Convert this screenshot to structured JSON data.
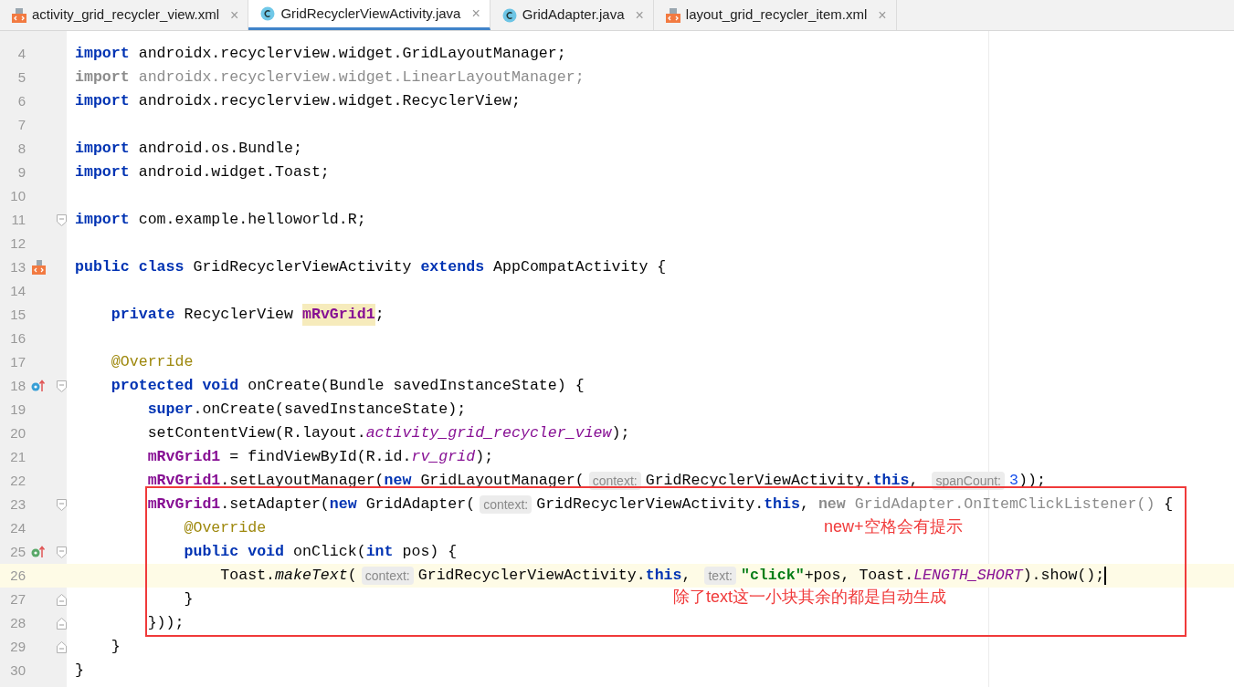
{
  "tabs": [
    {
      "label": "activity_grid_recycler_view.xml",
      "kind": "xml",
      "selected": false,
      "close": "×"
    },
    {
      "label": "GridRecyclerViewActivity.java",
      "kind": "class",
      "selected": true,
      "close": "×"
    },
    {
      "label": "GridAdapter.java",
      "kind": "class",
      "selected": false,
      "close": "×"
    },
    {
      "label": "layout_grid_recycler_item.xml",
      "kind": "xml",
      "selected": false,
      "close": "×"
    }
  ],
  "editor": {
    "lines": [
      {
        "number": "4",
        "tokens": [
          {
            "kind": "kw",
            "text": "import"
          },
          {
            "kind": "plain",
            "text": " androidx.recyclerview.widget.GridLayoutManager;"
          }
        ]
      },
      {
        "number": "5",
        "tokens": [
          {
            "kind": "unused_kw",
            "text": "import"
          },
          {
            "kind": "unused",
            "text": " androidx.recyclerview.widget.LinearLayoutManager;"
          }
        ]
      },
      {
        "number": "6",
        "tokens": [
          {
            "kind": "kw",
            "text": "import"
          },
          {
            "kind": "plain",
            "text": " androidx.recyclerview.widget.RecyclerView;"
          }
        ]
      },
      {
        "number": "7"
      },
      {
        "number": "8",
        "tokens": [
          {
            "kind": "kw",
            "text": "import"
          },
          {
            "kind": "plain",
            "text": " android.os.Bundle;"
          }
        ]
      },
      {
        "number": "9",
        "tokens": [
          {
            "kind": "kw",
            "text": "import"
          },
          {
            "kind": "plain",
            "text": " android.widget.Toast;"
          }
        ]
      },
      {
        "number": "10"
      },
      {
        "number": "11",
        "fold": {
          "kind": "open"
        },
        "tokens": [
          {
            "kind": "kw",
            "text": "import"
          },
          {
            "kind": "plain",
            "text": " com.example.helloworld.R;"
          }
        ]
      },
      {
        "number": "12"
      },
      {
        "number": "13",
        "marker": {
          "kind": "layout"
        },
        "tokens": [
          {
            "kind": "kw",
            "text": "public class"
          },
          {
            "kind": "plain",
            "text": " GridRecyclerViewActivity "
          },
          {
            "kind": "kw",
            "text": "extends"
          },
          {
            "kind": "plain",
            "text": " AppCompatActivity {"
          }
        ]
      },
      {
        "number": "14"
      },
      {
        "number": "15",
        "tokens": [
          {
            "kind": "kw",
            "text": "    private"
          },
          {
            "kind": "plain",
            "text": " RecyclerView "
          },
          {
            "kind": "field_hl",
            "text": "mRvGrid1"
          },
          {
            "kind": "plain",
            "text": ";"
          }
        ]
      },
      {
        "number": "16"
      },
      {
        "number": "17",
        "tokens": [
          {
            "kind": "ann",
            "text": "    @Override"
          }
        ]
      },
      {
        "number": "18",
        "marker": {
          "kind": "override"
        },
        "fold": {
          "kind": "open"
        },
        "tokens": [
          {
            "kind": "kw",
            "text": "    protected void"
          },
          {
            "kind": "plain",
            "text": " onCreate(Bundle savedInstanceState) {"
          }
        ]
      },
      {
        "number": "19",
        "tokens": [
          {
            "kind": "kw",
            "text": "        super"
          },
          {
            "kind": "plain",
            "text": ".onCreate(savedInstanceState);"
          }
        ]
      },
      {
        "number": "20",
        "tokens": [
          {
            "kind": "plain",
            "text": "        setContentView(R.layout."
          },
          {
            "kind": "static",
            "text": "activity_grid_recycler_view"
          },
          {
            "kind": "plain",
            "text": ");"
          }
        ]
      },
      {
        "number": "21",
        "tokens": [
          {
            "kind": "field",
            "text": "        mRvGrid1"
          },
          {
            "kind": "plain",
            "text": " = findViewById(R.id."
          },
          {
            "kind": "static",
            "text": "rv_grid"
          },
          {
            "kind": "plain",
            "text": ");"
          }
        ]
      },
      {
        "number": "22",
        "tokens": [
          {
            "kind": "field",
            "text": "        mRvGrid1"
          },
          {
            "kind": "plain",
            "text": ".setLayoutManager("
          },
          {
            "kind": "kw",
            "text": "new"
          },
          {
            "kind": "plain",
            "text": " GridLayoutManager("
          },
          {
            "kind": "hint",
            "text": "context:"
          },
          {
            "kind": "plain",
            "text": "GridRecyclerViewActivity."
          },
          {
            "kind": "kw",
            "text": "this"
          },
          {
            "kind": "plain",
            "text": ", "
          },
          {
            "kind": "hint",
            "text": "spanCount:"
          },
          {
            "kind": "num",
            "text": "3"
          },
          {
            "kind": "plain",
            "text": "));"
          }
        ]
      },
      {
        "number": "23",
        "fold": {
          "kind": "open"
        },
        "tokens": [
          {
            "kind": "field",
            "text": "        mRvGrid1"
          },
          {
            "kind": "plain",
            "text": ".setAdapter("
          },
          {
            "kind": "kw",
            "text": "new"
          },
          {
            "kind": "plain",
            "text": " GridAdapter("
          },
          {
            "kind": "hint",
            "text": "context:"
          },
          {
            "kind": "plain",
            "text": "GridRecyclerViewActivity."
          },
          {
            "kind": "kw",
            "text": "this"
          },
          {
            "kind": "plain",
            "text": ", "
          },
          {
            "kind": "unused_kw",
            "text": "new"
          },
          {
            "kind": "unused",
            "text": " GridAdapter.OnItemClickListener()"
          },
          {
            "kind": "plain",
            "text": " {"
          }
        ]
      },
      {
        "number": "24",
        "tokens": [
          {
            "kind": "ann",
            "text": "            @Override"
          }
        ]
      },
      {
        "number": "25",
        "marker": {
          "kind": "implement"
        },
        "fold": {
          "kind": "open"
        },
        "tokens": [
          {
            "kind": "kw",
            "text": "            public void"
          },
          {
            "kind": "plain",
            "text": " onClick("
          },
          {
            "kind": "kw",
            "text": "int"
          },
          {
            "kind": "plain",
            "text": " pos) {"
          }
        ]
      },
      {
        "number": "26",
        "current": true,
        "tokens": [
          {
            "kind": "plain",
            "text": "                Toast."
          },
          {
            "kind": "method_static",
            "text": "makeText"
          },
          {
            "kind": "plain",
            "text": "("
          },
          {
            "kind": "hint",
            "text": "context:"
          },
          {
            "kind": "plain",
            "text": "GridRecyclerViewActivity."
          },
          {
            "kind": "kw",
            "text": "this"
          },
          {
            "kind": "plain",
            "text": ", "
          },
          {
            "kind": "hint",
            "text": "text:"
          },
          {
            "kind": "str",
            "text": "\"click\""
          },
          {
            "kind": "plain",
            "text": "+pos, Toast."
          },
          {
            "kind": "static",
            "text": "LENGTH_SHORT"
          },
          {
            "kind": "plain",
            "text": ").show();"
          }
        ]
      },
      {
        "number": "27",
        "fold": {
          "kind": "close"
        },
        "tokens": [
          {
            "kind": "plain",
            "text": "            }"
          }
        ]
      },
      {
        "number": "28",
        "fold": {
          "kind": "close"
        },
        "tokens": [
          {
            "kind": "plain",
            "text": "        }));"
          }
        ]
      },
      {
        "number": "29",
        "fold": {
          "kind": "close"
        },
        "tokens": [
          {
            "kind": "plain",
            "text": "    }"
          }
        ]
      },
      {
        "number": "30",
        "tokens": [
          {
            "kind": "plain",
            "text": "}"
          }
        ]
      }
    ]
  },
  "annotation_box": {
    "notes": [
      "new+空格会有提示",
      "除了text这一小块其余的都是自动生成"
    ]
  }
}
